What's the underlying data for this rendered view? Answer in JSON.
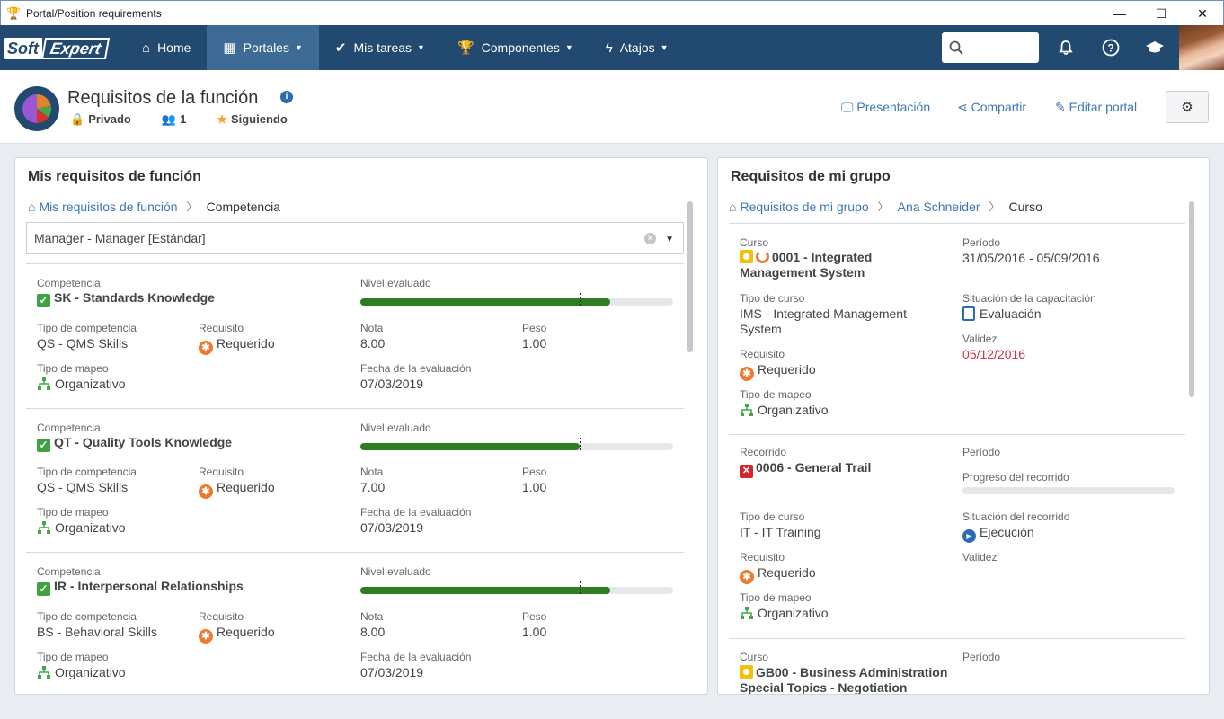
{
  "window": {
    "title": "Portal/Position requirements"
  },
  "nav": {
    "logo": {
      "part1": "Soft",
      "part2": "Expert"
    },
    "items": [
      {
        "label": "Home",
        "icon": "home-icon"
      },
      {
        "label": "Portales",
        "icon": "grid-icon"
      },
      {
        "label": "Mis tareas",
        "icon": "check-icon"
      },
      {
        "label": "Componentes",
        "icon": "trophy-icon"
      },
      {
        "label": "Atajos",
        "icon": "lightning-icon"
      }
    ]
  },
  "portal": {
    "title": "Requisitos de la función",
    "privacy": "Privado",
    "members": "1",
    "following": "Siguiendo",
    "actions": {
      "presentation": "Presentación",
      "share": "Compartir",
      "edit": "Editar portal"
    }
  },
  "left": {
    "title": "Mis requisitos de función",
    "breadcrumb": {
      "root": "Mis requisitos de función",
      "current": "Competencia"
    },
    "select_value": "Manager - Manager [Estándar]",
    "labels": {
      "competency": "Competencia",
      "level": "Nivel evaluado",
      "competency_type": "Tipo de competencia",
      "requirement": "Requisito",
      "grade": "Nota",
      "weight": "Peso",
      "mapping_type": "Tipo de mapeo",
      "eval_date": "Fecha de la evaluación"
    },
    "cards": [
      {
        "name": "SK - Standards Knowledge",
        "type": "QS - QMS Skills",
        "requirement": "Requerido",
        "grade": "8.00",
        "weight": "1.00",
        "mapping": "Organizativo",
        "date": "07/03/2019",
        "level_fill": 0.8,
        "level_mark": 0.7
      },
      {
        "name": "QT - Quality Tools Knowledge",
        "type": "QS - QMS Skills",
        "requirement": "Requerido",
        "grade": "7.00",
        "weight": "1.00",
        "mapping": "Organizativo",
        "date": "07/03/2019",
        "level_fill": 0.7,
        "level_mark": 0.7
      },
      {
        "name": "IR - Interpersonal Relationships",
        "type": "BS - Behavioral Skills",
        "requirement": "Requerido",
        "grade": "8.00",
        "weight": "1.00",
        "mapping": "Organizativo",
        "date": "07/03/2019",
        "level_fill": 0.8,
        "level_mark": 0.7
      }
    ]
  },
  "right": {
    "title": "Requisitos de mi grupo",
    "breadcrumb": {
      "root": "Requisitos de mi grupo",
      "middle": "Ana Schneider",
      "current": "Curso"
    },
    "card1": {
      "kind_label": "Curso",
      "name_line1": "0001 - Integrated",
      "name_line2": "Management System",
      "period_label": "Período",
      "period": "31/05/2016  -  05/09/2016",
      "course_type_label": "Tipo de curso",
      "course_type_line1": "IMS - Integrated Management",
      "course_type_line2": "System",
      "training_status_label": "Situación de la capacitación",
      "training_status": "Evaluación",
      "requirement_label": "Requisito",
      "requirement": "Requerido",
      "validity_label": "Validez",
      "validity": "05/12/2016",
      "mapping_label": "Tipo de mapeo",
      "mapping": "Organizativo"
    },
    "card2": {
      "kind_label": "Recorrido",
      "name": "0006 - General Trail",
      "period_label": "Período",
      "progress_label": "Progreso del recorrido",
      "progress": 0,
      "course_type_label": "Tipo de curso",
      "course_type": "IT - IT Training",
      "trail_status_label": "Situación del recorrido",
      "trail_status": "Ejecución",
      "requirement_label": "Requisito",
      "requirement": "Requerido",
      "validity_label": "Validez",
      "mapping_label": "Tipo de mapeo",
      "mapping": "Organizativo"
    },
    "card3": {
      "kind_label": "Curso",
      "name_line1": "GB00 - Business Administration",
      "name_line2": "Special Topics - Negotiation",
      "period_label": "Período"
    }
  }
}
